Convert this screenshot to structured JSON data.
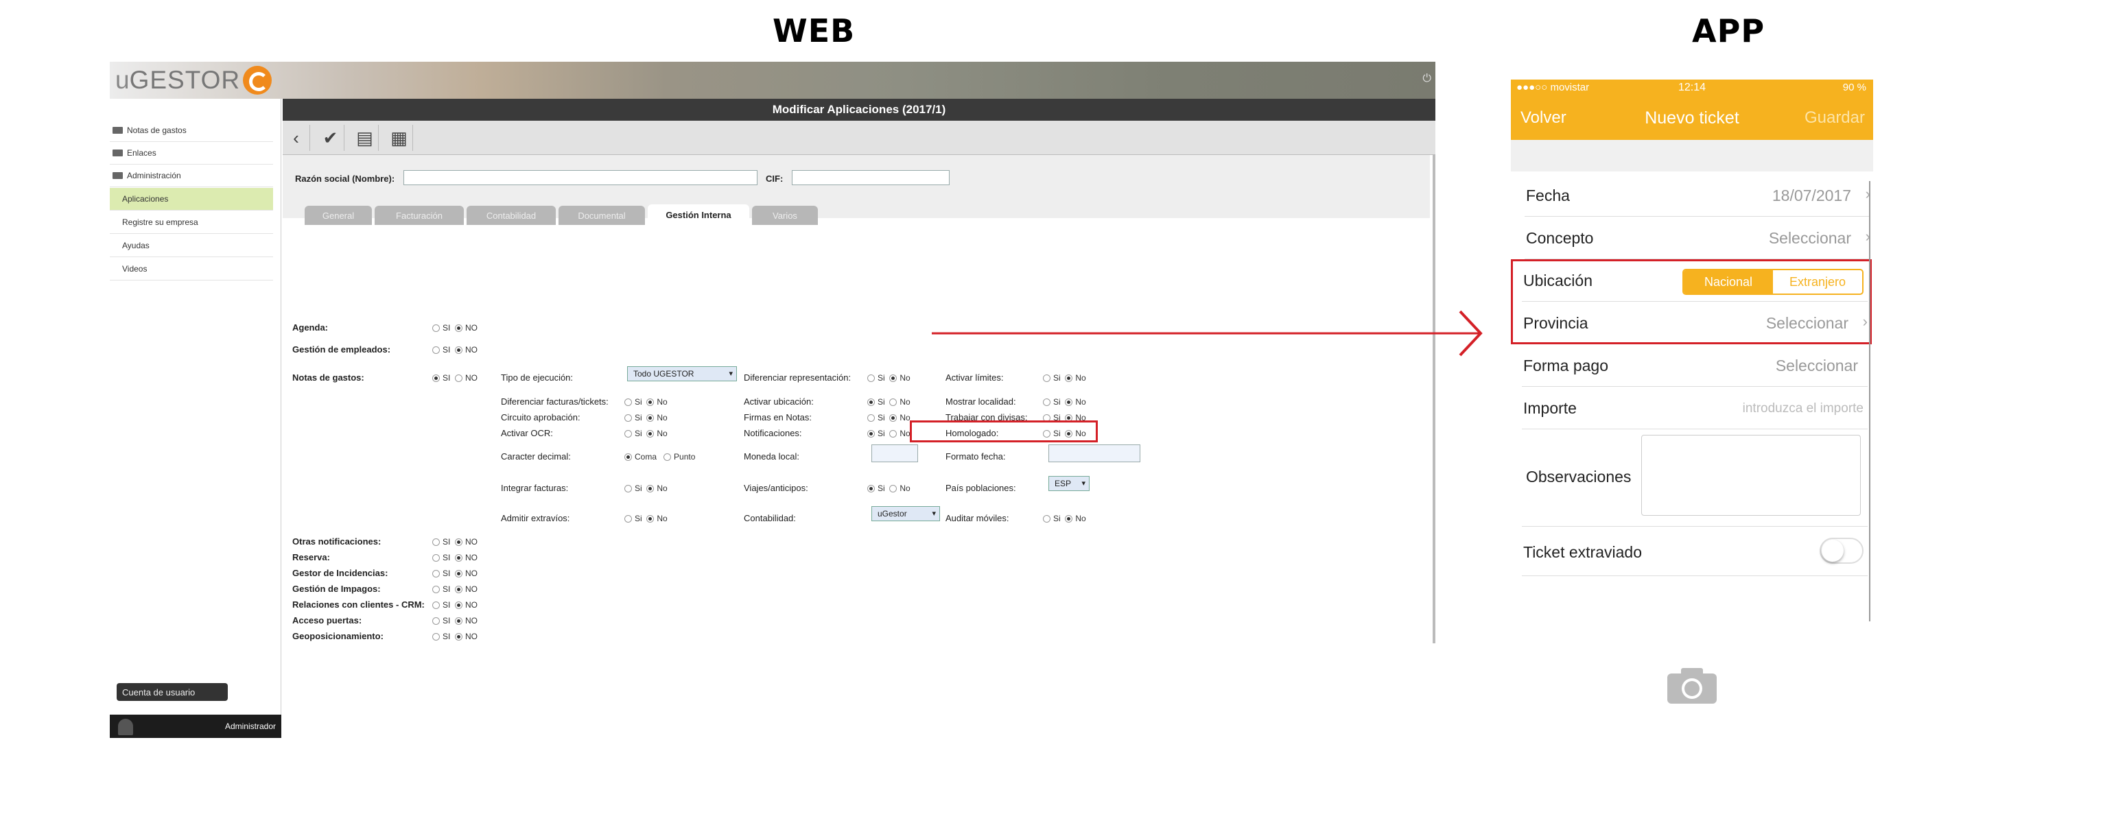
{
  "labels": {
    "web": "WEB",
    "app": "APP"
  },
  "web": {
    "logo": {
      "u": "u",
      "gestor": "GESTOR"
    },
    "sidebar": {
      "items": [
        {
          "label": "Notas de gastos",
          "folder": true
        },
        {
          "label": "Enlaces",
          "folder": true
        },
        {
          "label": "Administración",
          "folder": true
        },
        {
          "label": "Aplicaciones",
          "active": true
        },
        {
          "label": "Registre su empresa"
        },
        {
          "label": "Ayudas"
        },
        {
          "label": "Videos"
        }
      ],
      "tooltip": "Cuenta de usuario",
      "user": "Administrador"
    },
    "title": "Modificar Aplicaciones (2017/1)",
    "toolbar_icons": [
      "back-icon",
      "check-icon",
      "document-icon",
      "calendar-icon"
    ],
    "form": {
      "razon_label": "Razón social (Nombre):",
      "cif_label": "CIF:",
      "tabs": [
        "General",
        "Facturación",
        "Contabilidad",
        "Documental",
        "Gestión Interna",
        "Varios"
      ],
      "active_tab": "Gestión Interna"
    },
    "settings": {
      "agenda": "Agenda:",
      "empleados": "Gestión de empleados:",
      "notas": "Notas de gastos:",
      "si": "SI",
      "no": "NO",
      "si2": "Si",
      "no2": "No",
      "tipo_ejec": "Tipo de ejecución:",
      "tipo_val": "Todo UGESTOR",
      "dif_fact": "Diferenciar facturas/tickets:",
      "circuito": "Circuito aprobación:",
      "ocr": "Activar OCR:",
      "caracter": "Caracter decimal:",
      "coma": "Coma",
      "punto": "Punto",
      "integrar": "Integrar facturas:",
      "admitir": "Admitir extravíos:",
      "dif_rep": "Diferenciar representación:",
      "act_ubic": "Activar ubicación:",
      "firmas": "Firmas en Notas:",
      "notif": "Notificaciones:",
      "moneda": "Moneda local:",
      "viajes": "Viajes/anticipos:",
      "contab": "Contabilidad:",
      "contab_val": "uGestor",
      "act_lim": "Activar límites:",
      "mostrar": "Mostrar localidad:",
      "divisas": "Trabajar con divisas:",
      "homolog": "Homologado:",
      "formato": "Formato fecha:",
      "pais": "País poblaciones:",
      "pais_val": "ESP",
      "auditar": "Auditar móviles:",
      "otras": "Otras notificaciones:",
      "reserva": "Reserva:",
      "incid": "Gestor de Incidencias:",
      "impagos": "Gestión de Impagos:",
      "crm": "Relaciones con clientes - CRM:",
      "puertas": "Acceso puertas:",
      "geo": "Geoposicionamiento:"
    }
  },
  "app": {
    "status": {
      "carrier": "●●●○○ movistar",
      "time": "12:14",
      "battery": "90 %"
    },
    "nav": {
      "back": "Volver",
      "title": "Nuevo ticket",
      "save": "Guardar"
    },
    "rows": {
      "fecha": "Fecha",
      "fecha_val": "18/07/2017",
      "concepto": "Concepto",
      "concepto_val": "Seleccionar",
      "ubicacion": "Ubicación",
      "nacional": "Nacional",
      "extranjero": "Extranjero",
      "provincia": "Provincia",
      "provincia_val": "Seleccionar",
      "forma": "Forma pago",
      "forma_val": "Seleccionar",
      "importe": "Importe",
      "importe_ph": "introduzca el importe",
      "obs": "Observaciones",
      "ticket": "Ticket extraviado"
    },
    "ticket_extraviado": false
  },
  "colors": {
    "accent": "#f6b21f",
    "highlight": "#d42027",
    "sidebar_active": "#dcebb0"
  }
}
